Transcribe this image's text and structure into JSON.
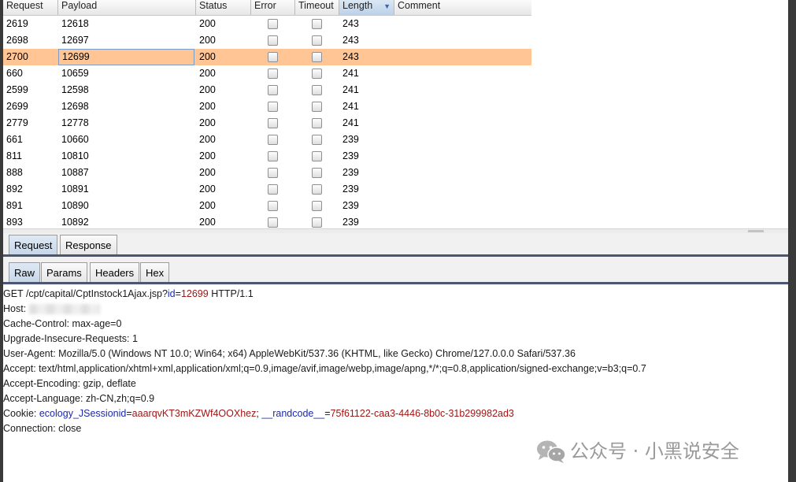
{
  "table": {
    "columns": [
      "Request",
      "Payload",
      "Status",
      "Error",
      "Timeout",
      "Length",
      "Comment"
    ],
    "sort_indicator": "▼",
    "rows": [
      {
        "request": "2619",
        "payload": "12618",
        "status": "200",
        "length": "243"
      },
      {
        "request": "2698",
        "payload": "12697",
        "status": "200",
        "length": "243"
      },
      {
        "request": "2700",
        "payload": "12699",
        "status": "200",
        "length": "243"
      },
      {
        "request": "660",
        "payload": "10659",
        "status": "200",
        "length": "241"
      },
      {
        "request": "2599",
        "payload": "12598",
        "status": "200",
        "length": "241"
      },
      {
        "request": "2699",
        "payload": "12698",
        "status": "200",
        "length": "241"
      },
      {
        "request": "2779",
        "payload": "12778",
        "status": "200",
        "length": "241"
      },
      {
        "request": "661",
        "payload": "10660",
        "status": "200",
        "length": "239"
      },
      {
        "request": "811",
        "payload": "10810",
        "status": "200",
        "length": "239"
      },
      {
        "request": "888",
        "payload": "10887",
        "status": "200",
        "length": "239"
      },
      {
        "request": "892",
        "payload": "10891",
        "status": "200",
        "length": "239"
      },
      {
        "request": "891",
        "payload": "10890",
        "status": "200",
        "length": "239"
      },
      {
        "request": "893",
        "payload": "10892",
        "status": "200",
        "length": "239"
      }
    ],
    "selected_row": 2,
    "selected_color": "#ffc595"
  },
  "message_tabs": [
    "Request",
    "Response"
  ],
  "view_tabs": [
    "Raw",
    "Params",
    "Headers",
    "Hex"
  ],
  "raw": {
    "line1_a": "GET /cpt/capital/CptInstock1Ajax.jsp?",
    "line1_param": "id",
    "line1_eq": "=",
    "line1_val": "12699",
    "line1_b": " HTTP/1.1",
    "host_label": "Host: ",
    "cache_control": "Cache-Control: max-age=0",
    "upgrade": "Upgrade-Insecure-Requests: 1",
    "user_agent": "User-Agent: Mozilla/5.0 (Windows NT 10.0; Win64; x64) AppleWebKit/537.36 (KHTML, like Gecko) Chrome/127.0.0.0 Safari/537.36",
    "accept": "Accept: text/html,application/xhtml+xml,application/xml;q=0.9,image/avif,image/webp,image/apng,*/*;q=0.8,application/signed-exchange;v=b3;q=0.7",
    "accept_encoding": "Accept-Encoding: gzip, deflate",
    "accept_language": "Accept-Language: zh-CN,zh;q=0.9",
    "cookie_label": "Cookie: ",
    "cookie1_name": "ecology_JSessionid",
    "cookie1_val": "aaarqvKT3mKZWf4OOXhez",
    "cookie_sep": "; ",
    "cookie2_name": "__randcode__",
    "cookie2_val": "75f61122-caa3-4446-8b0c-31b299982ad3",
    "connection": "Connection: close"
  },
  "watermark": {
    "text": "公众号 · 小黑说安全",
    "icon": "wechat-icon"
  },
  "colors": {
    "param_name": "#1a2aa6",
    "param_value": "#a01515",
    "tab_bar_line": "#4b5670"
  }
}
